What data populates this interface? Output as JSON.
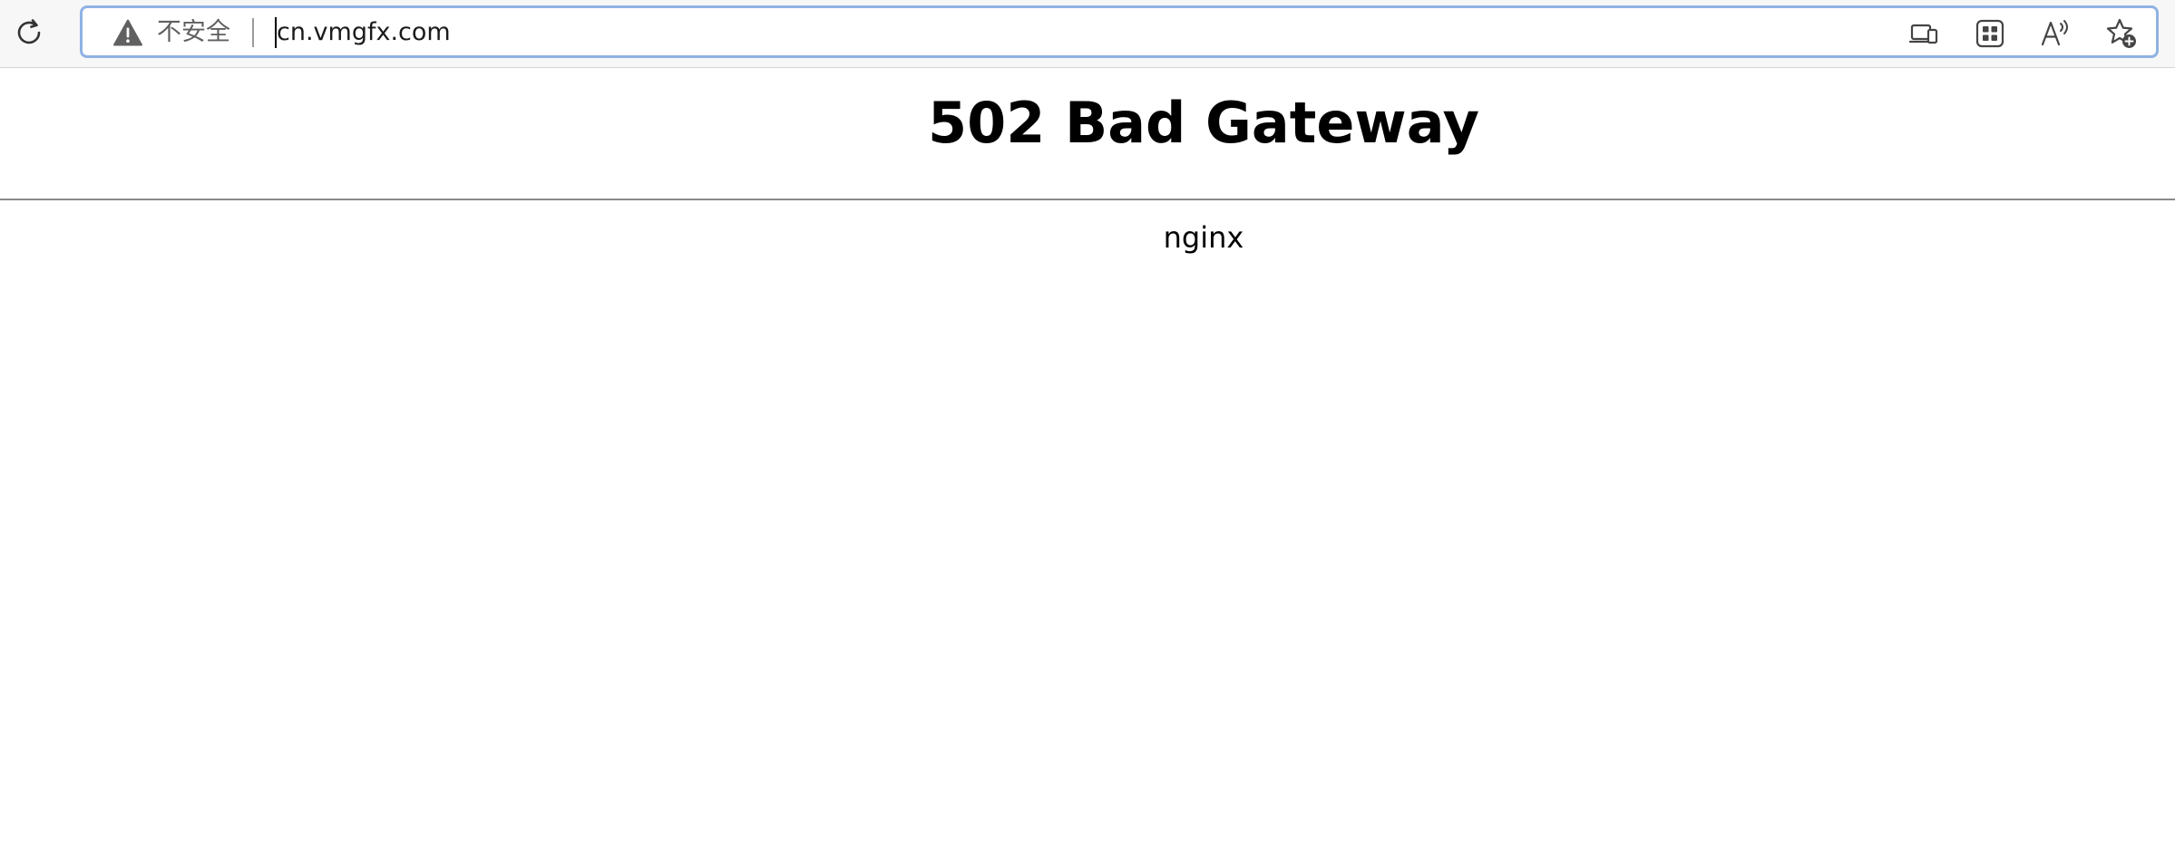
{
  "browser": {
    "security_label": "不安全",
    "url": "cn.vmgfx.com",
    "icons": {
      "reload": "reload-icon",
      "security": "warning-icon",
      "open_in_app": "open-in-app-icon",
      "apps": "apps-grid-icon",
      "read_aloud": "read-aloud-icon",
      "favorites": "add-favorite-icon"
    }
  },
  "page": {
    "heading": "502 Bad Gateway",
    "server": "nginx"
  }
}
